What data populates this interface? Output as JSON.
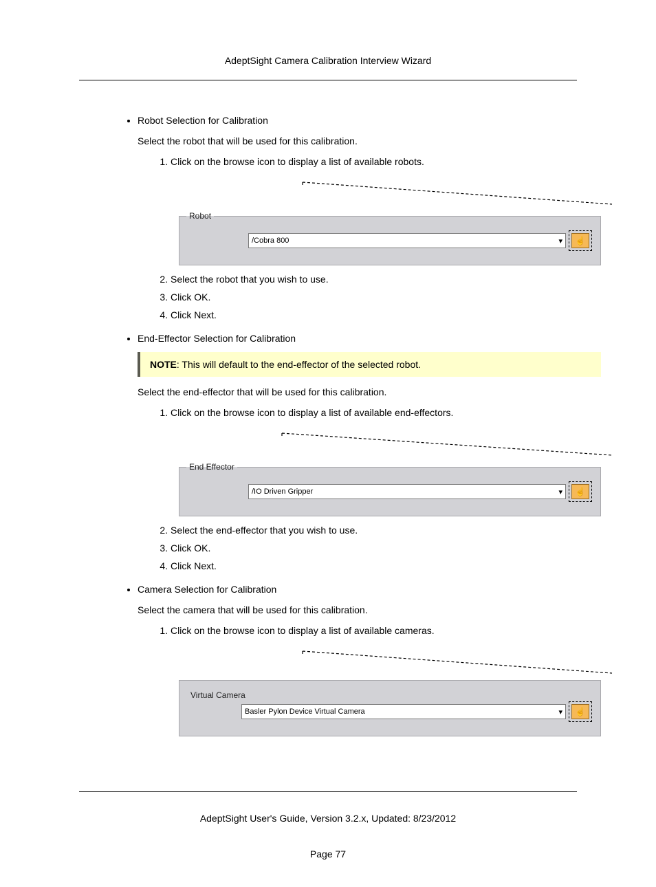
{
  "header": {
    "title": "AdeptSight Camera Calibration Interview Wizard"
  },
  "sections": [
    {
      "heading": "Robot Selection for Calibration",
      "intro": "Select the robot that will be used for this calibration.",
      "steps_a": [
        "Click on the browse icon to display a list of available robots."
      ],
      "fieldset": {
        "legend": "Robot",
        "value": "/Cobra 800"
      },
      "steps_b_start": 2,
      "steps_b": [
        "Select the robot that you wish to use.",
        "Click OK.",
        "Click Next."
      ]
    },
    {
      "heading": "End-Effector Selection for Calibration",
      "note_prefix": "NOTE",
      "note_text": ": This will default to the end-effector of the selected robot.",
      "intro": "Select the end-effector that will be used for this calibration.",
      "steps_a": [
        "Click on the browse icon to display a list of available end-effectors."
      ],
      "fieldset": {
        "legend": "End Effector",
        "value": "/IO Driven Gripper"
      },
      "steps_b_start": 2,
      "steps_b": [
        "Select the end-effector that you wish to use.",
        "Click OK.",
        "Click Next."
      ]
    },
    {
      "heading": "Camera Selection for Calibration",
      "intro": "Select the camera that will be used for this calibration.",
      "steps_a": [
        "Click on the browse icon to display a list of available cameras."
      ],
      "fieldset": {
        "legend": "Virtual Camera",
        "value": "Basler Pylon Device Virtual Camera"
      }
    }
  ],
  "footer": {
    "line": "AdeptSight User's Guide,  Version 3.2.x, Updated: 8/23/2012",
    "page": "Page 77"
  }
}
